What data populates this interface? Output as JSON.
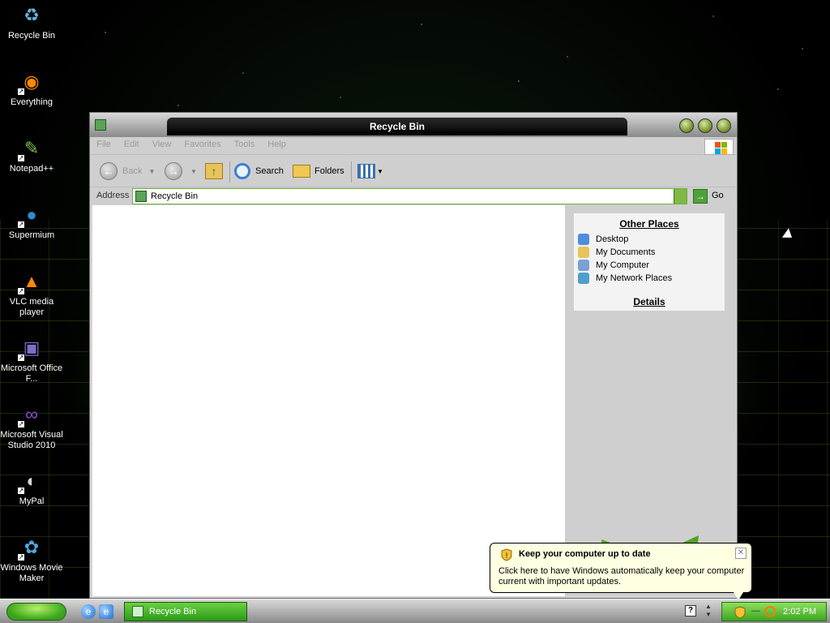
{
  "desktop": {
    "icons": [
      {
        "label": "Recycle Bin",
        "icon": "recycle-bin-icon",
        "glyph": "♻",
        "color": "#62b4d9",
        "shortcut": false
      },
      {
        "label": "Everything",
        "icon": "everything-icon",
        "glyph": "◉",
        "color": "#ff8a00",
        "shortcut": true
      },
      {
        "label": "Notepad++",
        "icon": "notepad-plus-plus-icon",
        "glyph": "✎",
        "color": "#7dc34f",
        "shortcut": true
      },
      {
        "label": "Supermium",
        "icon": "supermium-icon",
        "glyph": "●",
        "color": "#2f8bd0",
        "shortcut": true
      },
      {
        "label": "VLC media player",
        "icon": "vlc-icon",
        "glyph": "▲",
        "color": "#ff8800",
        "shortcut": true
      },
      {
        "label": "Microsoft Office F...",
        "icon": "office-icon",
        "glyph": "▣",
        "color": "#7b6fc9",
        "shortcut": true
      },
      {
        "label": "Microsoft Visual Studio 2010",
        "icon": "visual-studio-icon",
        "glyph": "∞",
        "color": "#8d4fd1",
        "shortcut": true
      },
      {
        "label": "MyPal",
        "icon": "mypal-icon",
        "glyph": "◐",
        "color": "#d8d8d8",
        "shortcut": true
      },
      {
        "label": "Windows Movie Maker",
        "icon": "movie-maker-icon",
        "glyph": "✿",
        "color": "#4fa6e0",
        "shortcut": true
      }
    ]
  },
  "window": {
    "title": "Recycle Bin",
    "menu": [
      "File",
      "Edit",
      "View",
      "Favorites",
      "Tools",
      "Help"
    ],
    "toolbar": {
      "back_label": "Back",
      "search_label": "Search",
      "folders_label": "Folders"
    },
    "address": {
      "label": "Address",
      "value": "Recycle Bin",
      "go_label": "Go"
    },
    "taskpane": {
      "other_places_title": "Other Places",
      "places": [
        {
          "label": "Desktop",
          "icon": "desktop-icon",
          "color": "#4f8de0"
        },
        {
          "label": "My Documents",
          "icon": "my-documents-icon",
          "color": "#e8c25a"
        },
        {
          "label": "My Computer",
          "icon": "my-computer-icon",
          "color": "#7aa0d6"
        },
        {
          "label": "My Network Places",
          "icon": "network-places-icon",
          "color": "#4fa0c8"
        }
      ],
      "details_title": "Details"
    }
  },
  "balloon": {
    "title": "Keep your computer up to date",
    "text": "Click here to have Windows automatically keep your computer current with important updates.",
    "close_glyph": "✕"
  },
  "taskbar": {
    "task_label": "Recycle Bin",
    "clock": "2:02 PM",
    "help_glyph": "?"
  },
  "colors": {
    "accent_green": "#3ca522",
    "balloon_bg": "#ffffe1"
  }
}
